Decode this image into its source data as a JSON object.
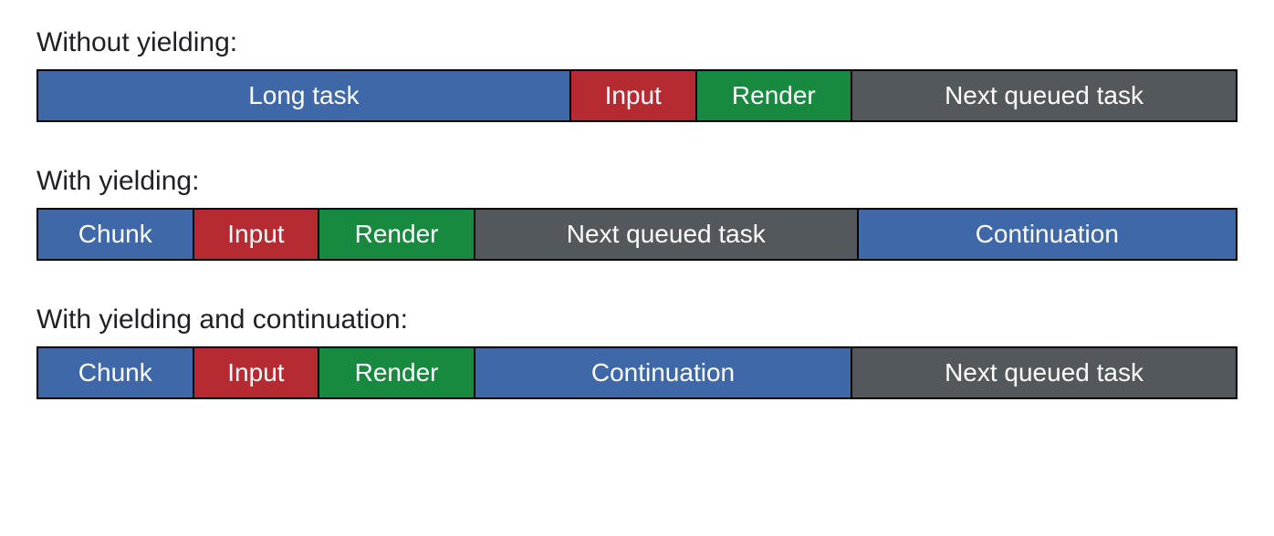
{
  "sections": [
    {
      "title": "Without yielding:",
      "segments": [
        {
          "label": "Long task",
          "color": "blue",
          "width": 44.5
        },
        {
          "label": "Input",
          "color": "red",
          "width": 10.5
        },
        {
          "label": "Render",
          "color": "green",
          "width": 13
        },
        {
          "label": "Next queued task",
          "color": "gray",
          "width": 32
        }
      ]
    },
    {
      "title": "With yielding:",
      "segments": [
        {
          "label": "Chunk",
          "color": "blue",
          "width": 13
        },
        {
          "label": "Input",
          "color": "red",
          "width": 10.5
        },
        {
          "label": "Render",
          "color": "green",
          "width": 13
        },
        {
          "label": "Next queued task",
          "color": "gray",
          "width": 32
        },
        {
          "label": "Continuation",
          "color": "blue",
          "width": 31.5
        }
      ]
    },
    {
      "title": "With yielding and continuation:",
      "segments": [
        {
          "label": "Chunk",
          "color": "blue",
          "width": 13
        },
        {
          "label": "Input",
          "color": "red",
          "width": 10.5
        },
        {
          "label": "Render",
          "color": "green",
          "width": 13
        },
        {
          "label": "Continuation",
          "color": "blue",
          "width": 31.5
        },
        {
          "label": "Next queued task",
          "color": "gray",
          "width": 32
        }
      ]
    }
  ]
}
